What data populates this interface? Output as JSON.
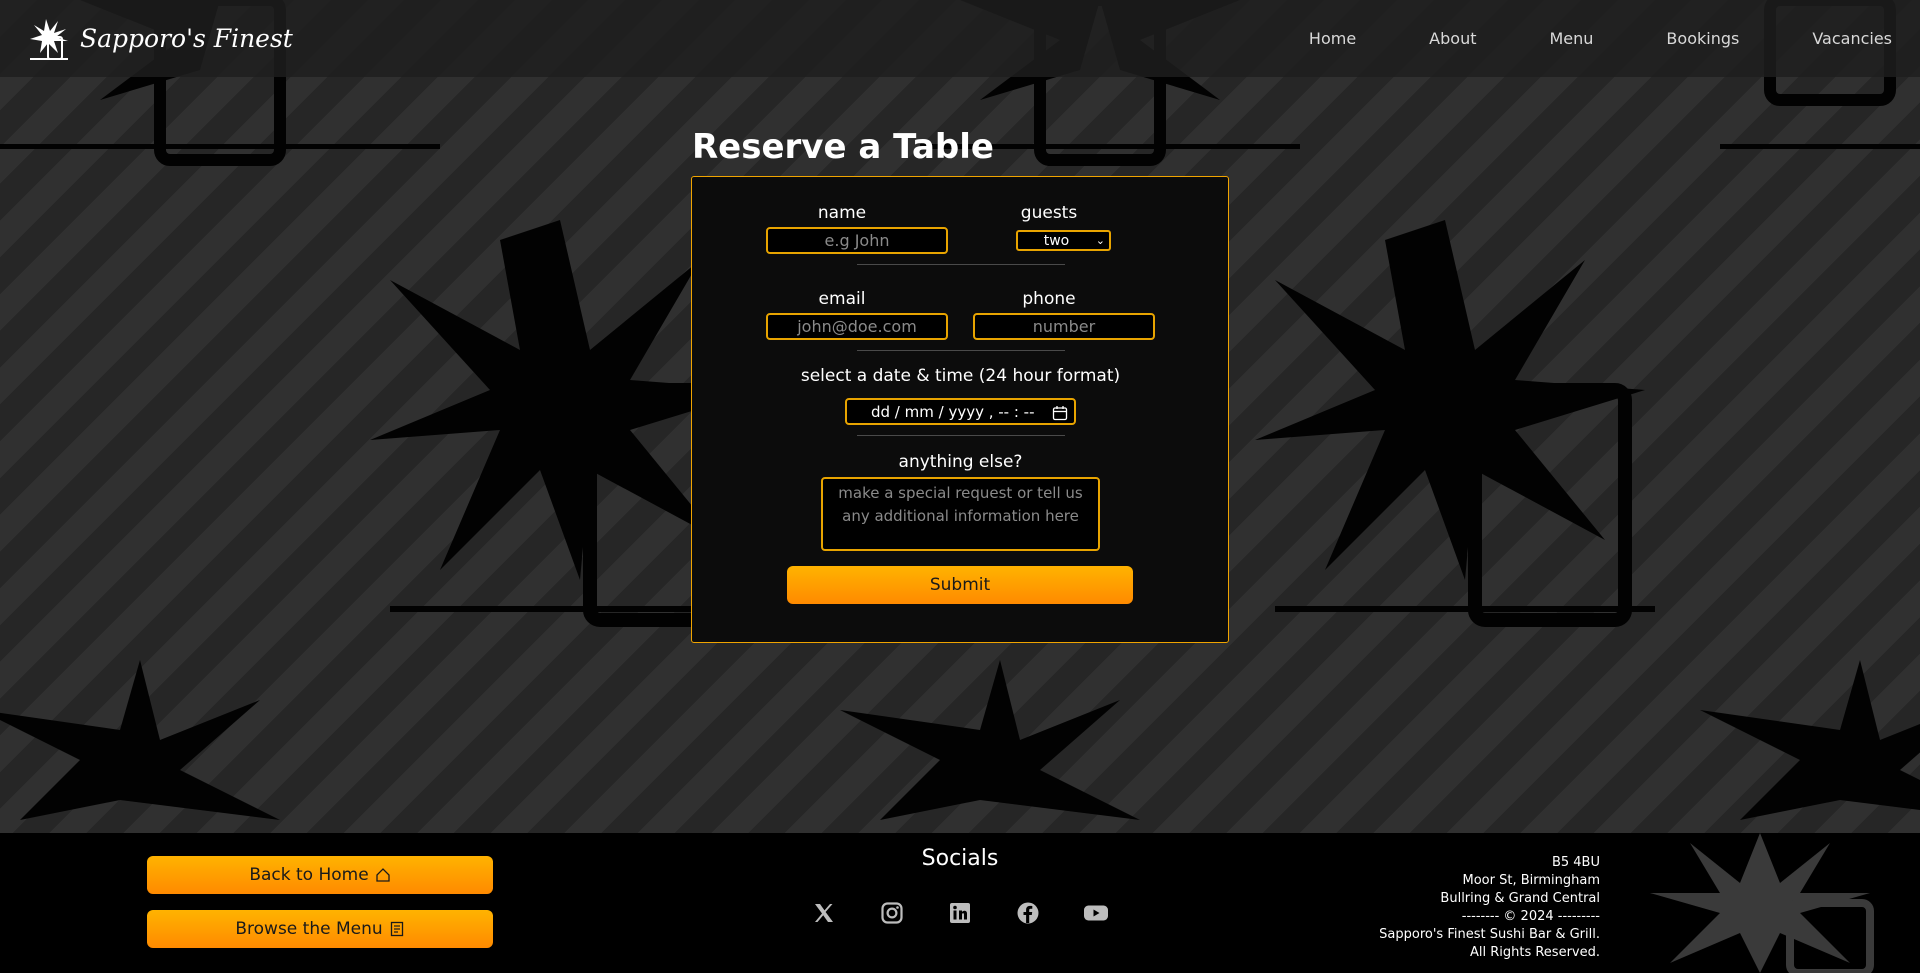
{
  "header": {
    "brand": "Sapporo's Finest",
    "nav": [
      "Home",
      "About",
      "Menu",
      "Bookings",
      "Vacancies"
    ]
  },
  "main": {
    "title": "Reserve a Table",
    "form": {
      "name_label": "name",
      "name_placeholder": "e.g John",
      "guests_label": "guests",
      "guests_value": "two",
      "email_label": "email",
      "email_placeholder": "john@doe.com",
      "phone_label": "phone",
      "phone_placeholder": "number",
      "datetime_label": "select a date & time (24 hour format)",
      "datetime_placeholder": "dd / mm / yyyy ,  -- : --",
      "notes_label": "anything else?",
      "notes_placeholder": "make a special request or tell us any additional information here",
      "submit_label": "Submit"
    }
  },
  "footer": {
    "back_home_label": "Back to Home",
    "browse_menu_label": "Browse the Menu",
    "socials_title": "Socials",
    "socials": [
      "x-icon",
      "instagram-icon",
      "linkedin-icon",
      "facebook-icon",
      "youtube-icon"
    ],
    "address": {
      "postcode": "B5 4BU",
      "street": "Moor St, Birmingham",
      "area": "Bullring & Grand Central",
      "copyright": "-------- © 2024 ---------",
      "company": "Sapporo's Finest Sushi Bar & Grill.",
      "rights": "All Rights Reserved."
    }
  },
  "colors": {
    "accent": "#f0a400",
    "button_top": "#ffb300",
    "button_bottom": "#ff8a00",
    "card_bg": "#0c0c0c",
    "footer_bg": "#000000"
  }
}
